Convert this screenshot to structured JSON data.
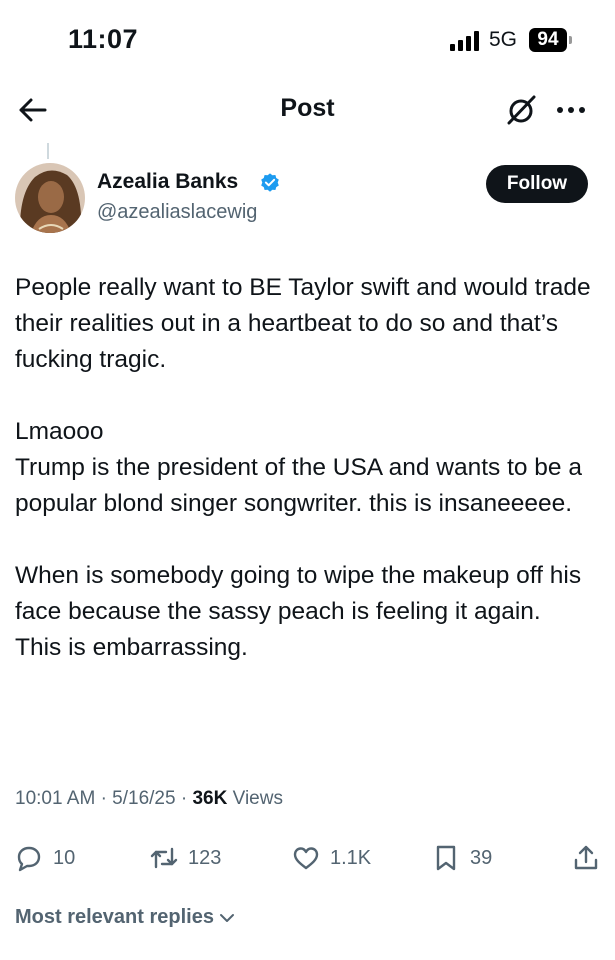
{
  "status_bar": {
    "time": "11:07",
    "network": "5G",
    "battery": "94"
  },
  "nav": {
    "title": "Post",
    "back_icon": "arrow-left-icon",
    "grok_icon": "grok-icon",
    "more_icon": "more-horizontal-icon"
  },
  "author": {
    "name": "Azealia Banks",
    "handle": "@azealiaslacewig",
    "verified": true,
    "verified_color": "#1d9bf0"
  },
  "follow_label": "Follow",
  "post": {
    "p1": "People really want to BE Taylor swift and would trade their realities out in a heartbeat to do so and that’s fucking tragic.",
    "p2a": "Lmaooo",
    "p2b": "Trump is the president of the USA and wants to be a popular blond singer songwriter.  this is insaneeeee.",
    "p3a": "When is somebody going to wipe the makeup off his face because the sassy peach is feeling it again.",
    "p3b": "This is embarrassing."
  },
  "meta": {
    "time": "10:01 AM",
    "sep1": "·",
    "date": "5/16/25",
    "sep2": "·",
    "views_count": "36K",
    "views_label": "Views"
  },
  "actions": {
    "replies": "10",
    "reposts": "123",
    "likes": "1.1K",
    "bookmarks": "39"
  },
  "replies_filter": "Most relevant replies"
}
